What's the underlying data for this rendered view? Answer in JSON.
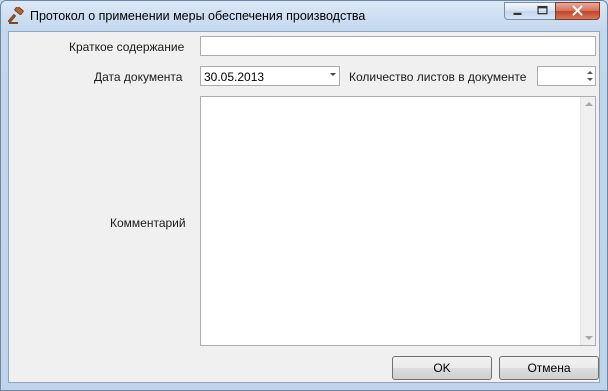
{
  "window": {
    "title": "Протокол о применении меры обеспечения производства",
    "icon": "gavel-icon"
  },
  "form": {
    "summary_label": "Краткое содержание",
    "summary_value": "",
    "date_label": "Дата документа",
    "date_value": "30.05.2013",
    "pages_label": "Количество листов в документе",
    "pages_value": "",
    "comment_label": "Комментарий",
    "comment_value": ""
  },
  "buttons": {
    "ok": "OK",
    "cancel": "Отмена"
  },
  "colors": {
    "title_bar": "#c3d7ee",
    "close_button": "#c3442a",
    "client_bg": "#f0f0f0"
  }
}
